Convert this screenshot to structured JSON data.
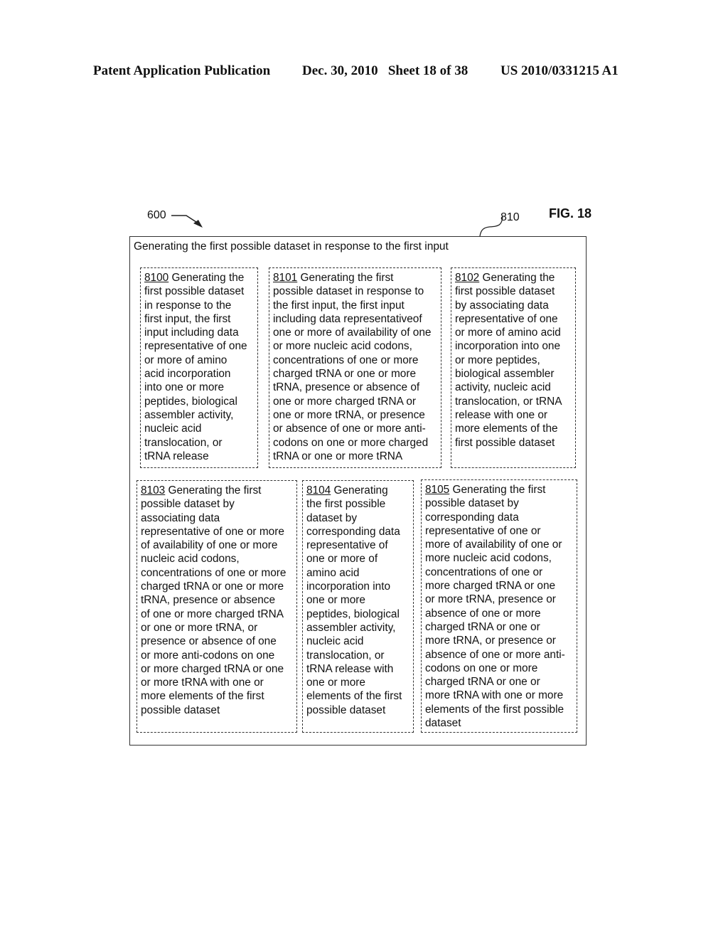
{
  "header": {
    "publication": "Patent Application Publication",
    "date_sheet": "Dec. 30, 2010   Sheet 18 of 38",
    "number": "US 2010/0331215 A1"
  },
  "figure": {
    "label": "FIG. 18",
    "ref_600": "600",
    "ref_810": "810",
    "outer_title": "Generating the first possible dataset in response to the first input",
    "boxes": [
      {
        "num": "8100",
        "lines": [
          " Generating the",
          "first possible dataset",
          "in response to the",
          "first input, the first",
          "input including data",
          "representative of one",
          "or more of amino",
          "acid incorporation",
          "into one or more",
          "peptides, biological",
          "assembler activity,",
          "nucleic acid",
          "translocation, or",
          "tRNA release"
        ]
      },
      {
        "num": "8101",
        "lines": [
          " Generating the first",
          "possible dataset in response to",
          "the first input, the first input",
          "including data representativeof",
          "one or more of availability of one",
          "or more nucleic acid codons,",
          "concentrations of one or more",
          "charged tRNA or one or more",
          "tRNA, presence or absence of",
          "one or more charged tRNA or",
          "one or more tRNA, or presence",
          "or absence of one or more anti-",
          "codons on one or more charged",
          "tRNA or one or more tRNA"
        ]
      },
      {
        "num": "8102",
        "lines": [
          " Generating the",
          "first possible dataset",
          "by associating data",
          "representative of one",
          "or more of amino acid",
          "incorporation into one",
          "or more peptides,",
          "biological assembler",
          "activity, nucleic acid",
          "translocation, or tRNA",
          "release with one or",
          "more elements of the",
          "first possible dataset"
        ]
      },
      {
        "num": "8103",
        "lines": [
          " Generating the first",
          "possible dataset by",
          "associating data",
          "representative of one or more",
          "of availability of one or more",
          "nucleic acid codons,",
          "concentrations of one or more",
          "charged tRNA or one or more",
          "tRNA, presence or absence",
          "of one or more charged tRNA",
          "or one or more tRNA, or",
          "presence or absence of one",
          "or more anti-codons on one",
          "or more charged tRNA or one",
          "or more tRNA with one or",
          "more elements of the first",
          "possible dataset"
        ]
      },
      {
        "num": "8104",
        "lines": [
          " Generating",
          "the first possible",
          "dataset by",
          "corresponding data",
          "representative of",
          "one or more of",
          "amino acid",
          "incorporation into",
          "one or more",
          "peptides, biological",
          "assembler activity,",
          "nucleic acid",
          "translocation, or",
          "tRNA release with",
          "one or more",
          "elements of the first",
          "possible dataset"
        ]
      },
      {
        "num": "8105",
        "lines": [
          " Generating the first",
          "possible dataset by",
          "corresponding data",
          "representative of one or",
          "more of availability of one or",
          "more nucleic acid codons,",
          "concentrations of one or",
          "more charged tRNA or one",
          "or more tRNA, presence or",
          "absence of one or more",
          "charged tRNA or one or",
          "more tRNA, or presence or",
          "absence of one or more anti-",
          "codons on one or more",
          "charged tRNA or one or",
          "more tRNA with one or more",
          "elements of the first possible",
          "dataset"
        ]
      }
    ]
  }
}
